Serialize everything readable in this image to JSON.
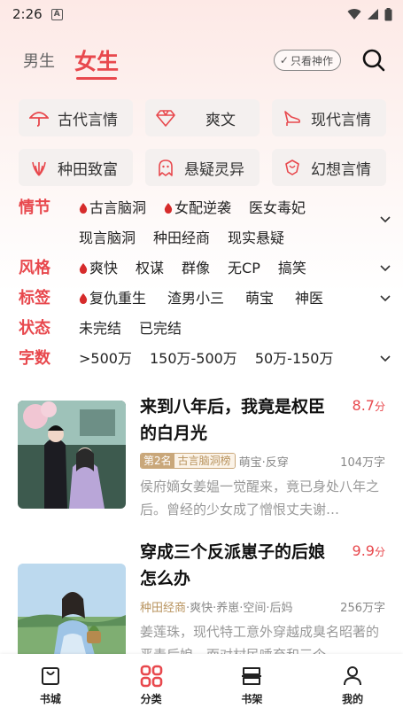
{
  "status": {
    "time": "2:26",
    "notif": "A"
  },
  "header": {
    "tab_male": "男生",
    "tab_female": "女生",
    "filter_pill": "只看神作",
    "colors": {
      "accent": "#e8484d"
    }
  },
  "categories": [
    {
      "label": "古代言情",
      "icon": "umbrella-icon"
    },
    {
      "label": "爽文",
      "icon": "diamond-icon"
    },
    {
      "label": "现代言情",
      "icon": "high-heel-icon"
    },
    {
      "label": "种田致富",
      "icon": "wheat-icon"
    },
    {
      "label": "悬疑灵异",
      "icon": "ghost-icon"
    },
    {
      "label": "幻想言情",
      "icon": "rose-icon"
    }
  ],
  "filters": {
    "plot": {
      "label": "情节",
      "options": [
        "古言脑洞",
        "女配逆袭",
        "医女毒妃",
        "现言脑洞",
        "种田经商",
        "现实悬疑"
      ]
    },
    "style": {
      "label": "风格",
      "options": [
        "爽快",
        "权谋",
        "群像",
        "无CP",
        "搞笑"
      ]
    },
    "tags": {
      "label": "标签",
      "options": [
        "复仇重生",
        "渣男小三",
        "萌宝",
        "神医"
      ]
    },
    "state": {
      "label": "状态",
      "options": [
        "未完结",
        "已完结"
      ]
    },
    "words": {
      "label": "字数",
      "options": [
        ">500万",
        "150万-500万",
        "50万-150万"
      ]
    }
  },
  "books": [
    {
      "title": "来到八年后，我竟是权臣的白月光",
      "score": "8.7",
      "score_unit": "分",
      "rank_no": "第2名",
      "rank_name": "古言脑洞榜",
      "tags": "萌宝·反穿",
      "words": "104万字",
      "desc": "侯府嫡女姜媪一觉醒来，竟已身处八年之后。曾经的少女成了憎恨丈夫谢…"
    },
    {
      "title": "穿成三个反派崽子的后娘怎么办",
      "score": "9.9",
      "score_unit": "分",
      "tag_main": "种田经商",
      "tags": "·爽快·养崽·空间·后妈",
      "words": "256万字",
      "desc": "姜莲珠，现代特工意外穿越成臭名昭著的恶毒后娘，面对村民唾弃和三个"
    }
  ],
  "bottom_nav": [
    {
      "label": "书城",
      "icon": "bag-icon"
    },
    {
      "label": "分类",
      "icon": "grid-icon"
    },
    {
      "label": "书架",
      "icon": "shelf-icon"
    },
    {
      "label": "我的",
      "icon": "person-icon"
    }
  ]
}
